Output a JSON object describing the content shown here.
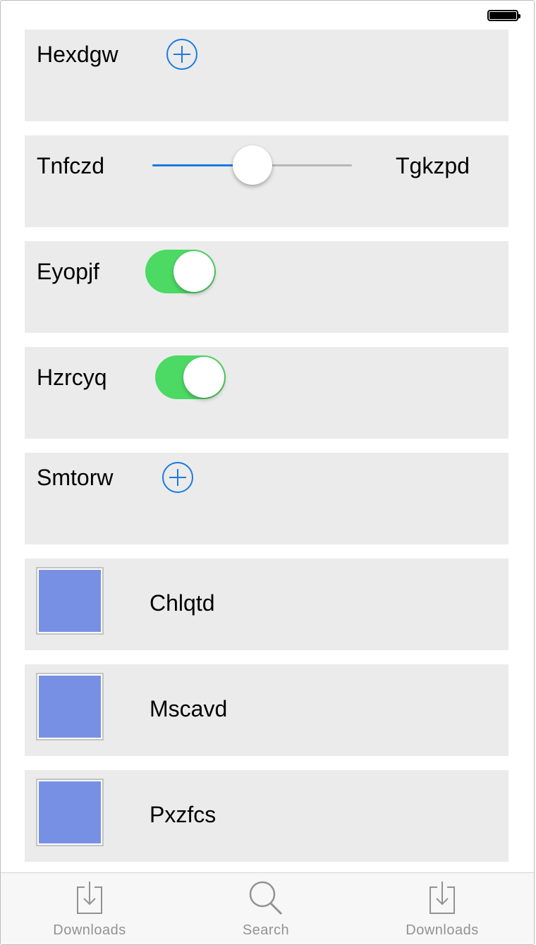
{
  "status_bar": {
    "battery_icon": "battery-full-icon"
  },
  "cells": [
    {
      "type": "add",
      "label": "Hexdgw",
      "icon": "add-circle-icon"
    },
    {
      "type": "slider",
      "min_label": "Tnfczd",
      "max_label": "Tgkzpd",
      "value": 0.5
    },
    {
      "type": "toggle",
      "label": "Eyopjf",
      "on": true
    },
    {
      "type": "toggle",
      "label": "Hzrcyq",
      "on": true
    },
    {
      "type": "add",
      "label": "Smtorw",
      "icon": "add-circle-icon"
    },
    {
      "type": "image",
      "label": "Chlqtd"
    },
    {
      "type": "image",
      "label": "Mscavd"
    },
    {
      "type": "image",
      "label": "Pxzfcs"
    }
  ],
  "tab_bar": {
    "tabs": [
      {
        "label": "Downloads",
        "icon": "download-icon"
      },
      {
        "label": "Search",
        "icon": "search-icon"
      },
      {
        "label": "Downloads",
        "icon": "download-icon"
      }
    ]
  },
  "colors": {
    "accent": "#1a7ae2",
    "toggle_on": "#4cd964",
    "cell_background": "#ebebeb",
    "image_placeholder": "#7890e4",
    "tab_inactive": "#929292"
  }
}
